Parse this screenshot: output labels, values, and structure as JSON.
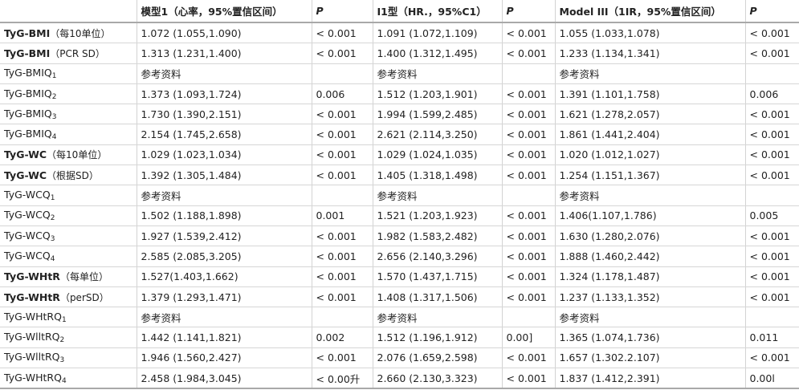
{
  "headers": {
    "row_label": "",
    "model1": "模型1（心率，95%置信区间）",
    "p1": "P",
    "model2": "I1型（HR.，95%C1）",
    "p2": "P",
    "model3": "Model III（1IR，95%置信区间）",
    "p3": "P"
  },
  "rows": [
    {
      "main": "TyG-BMI",
      "note": "（每10单位）",
      "bold": true,
      "sub": "",
      "m1": "1.072 (1.055,1.090)",
      "p1": "< 0.001",
      "m2": "1.091 (1.072,1.109)",
      "p2": "< 0.001",
      "m3": "1.055 (1.033,1.078)",
      "p3": "< 0.001"
    },
    {
      "main": "TyG-BMI",
      "note": "（PCR SD）",
      "bold": true,
      "sub": "",
      "m1": "1.313 (1.231,1.400)",
      "p1": "< 0.001",
      "m2": "1.400 (1.312,1.495)",
      "p2": "< 0.001",
      "m3": "1.233 (1.134,1.341)",
      "p3": "< 0.001"
    },
    {
      "main": "TyG-BMIQ",
      "note": "",
      "bold": false,
      "sub": "1",
      "m1": "参考资料",
      "p1": "",
      "m2": "参考资料",
      "p2": "",
      "m3": "参考资料",
      "p3": ""
    },
    {
      "main": "TyG-BMIQ",
      "note": "",
      "bold": false,
      "sub": "2",
      "m1": "1.373 (1.093,1.724)",
      "p1": "0.006",
      "m2": "1.512 (1.203,1.901)",
      "p2": "< 0.001",
      "m3": "1.391 (1.101,1.758)",
      "p3": "0.006"
    },
    {
      "main": "TyG-BMIQ",
      "note": "",
      "bold": false,
      "sub": "3",
      "m1": "1.730 (1.390,2.151)",
      "p1": "< 0.001",
      "m2": "1.994 (1.599,2.485)",
      "p2": "< 0.001",
      "m3": "1.621 (1.278,2.057)",
      "p3": "< 0.001"
    },
    {
      "main": "TyG-BMIQ",
      "note": "",
      "bold": false,
      "sub": "4",
      "m1": "2.154 (1.745,2.658)",
      "p1": "< 0.001",
      "m2": "2.621 (2.114,3.250)",
      "p2": "< 0.001",
      "m3": "1.861 (1.441,2.404)",
      "p3": "< 0.001"
    },
    {
      "main": "TyG-WC",
      "note": "（每10单位）",
      "bold": true,
      "sub": "",
      "m1": "1.029 (1.023,1.034)",
      "p1": "< 0.001",
      "m2": "1.029 (1.024,1.035)",
      "p2": "< 0.001",
      "m3": "1.020 (1.012,1.027)",
      "p3": "< 0.001"
    },
    {
      "main": "TyG-WC",
      "note": "（根据SD）",
      "bold": true,
      "sub": "",
      "m1": "1.392 (1.305,1.484)",
      "p1": "< 0.001",
      "m2": "1.405 (1.318,1.498)",
      "p2": "< 0.001",
      "m3": "1.254 (1.151,1.367)",
      "p3": "< 0.001"
    },
    {
      "main": "TyG-WCQ",
      "note": "",
      "bold": false,
      "sub": "1",
      "m1": "参考资料",
      "p1": "",
      "m2": "参考资料",
      "p2": "",
      "m3": "参考资料",
      "p3": ""
    },
    {
      "main": "TyG-WCQ",
      "note": "",
      "bold": false,
      "sub": "2",
      "m1": "1.502 (1.188,1.898)",
      "p1": "0.001",
      "m2": "1.521 (1.203,1.923)",
      "p2": "< 0.001",
      "m3": "1.406(1.107,1.786)",
      "p3": "0.005"
    },
    {
      "main": "TyG-WCQ",
      "note": "",
      "bold": false,
      "sub": "3",
      "m1": "1.927 (1.539,2.412)",
      "p1": "< 0.001",
      "m2": "1.982 (1.583,2.482)",
      "p2": "< 0.001",
      "m3": "1.630 (1.280,2.076)",
      "p3": "< 0.001"
    },
    {
      "main": "TyG-WCQ",
      "note": "",
      "bold": false,
      "sub": "4",
      "m1": "2.585 (2.085,3.205)",
      "p1": "< 0.001",
      "m2": "2.656 (2.140,3.296)",
      "p2": "< 0.001",
      "m3": "1.888 (1.460,2.442)",
      "p3": "< 0.001"
    },
    {
      "main": "TyG-WHtR",
      "note": "（每单位）",
      "bold": true,
      "sub": "",
      "m1": "1.527(1.403,1.662)",
      "p1": "< 0.001",
      "m2": "1.570 (1.437,1.715)",
      "p2": "< 0.001",
      "m3": "1.324 (1.178,1.487)",
      "p3": "< 0.001"
    },
    {
      "main": "TyG-WHtR",
      "note": "（perSD）",
      "bold": true,
      "sub": "",
      "m1": "1.379 (1.293,1.471)",
      "p1": "< 0.001",
      "m2": "1.408 (1.317,1.506)",
      "p2": "< 0.001",
      "m3": "1.237 (1.133,1.352)",
      "p3": "< 0.001"
    },
    {
      "main": "TyG-WHtRQ",
      "note": "",
      "bold": false,
      "sub": "1",
      "m1": "参考资料",
      "p1": "",
      "m2": "参考资料",
      "p2": "",
      "m3": "参考资料",
      "p3": ""
    },
    {
      "main": "TyG-WlltRQ",
      "note": "",
      "bold": false,
      "sub": "2",
      "m1": "1.442 (1.141,1.821)",
      "p1": "0.002",
      "m2": "1.512 (1.196,1.912)",
      "p2": "0.00]",
      "m3": "1.365 (1.074,1.736)",
      "p3": "0.011"
    },
    {
      "main": "TyG-WlltRQ",
      "note": "",
      "bold": false,
      "sub": "3",
      "m1": "1.946 (1.560,2.427)",
      "p1": "< 0.001",
      "m2": "2.076 (1.659,2.598)",
      "p2": "< 0.001",
      "m3": "1.657 (1.302.2.107)",
      "p3": "< 0.001"
    },
    {
      "main": "TyG-WHtRQ",
      "note": "",
      "bold": false,
      "sub": "4",
      "m1": "2.458 (1.984,3.045)",
      "p1": "< 0.00升",
      "m2": "2.660 (2.130,3.323)",
      "p2": "< 0.001",
      "m3": "1.837 (1.412,2.391)",
      "p3": "0.00l"
    }
  ]
}
